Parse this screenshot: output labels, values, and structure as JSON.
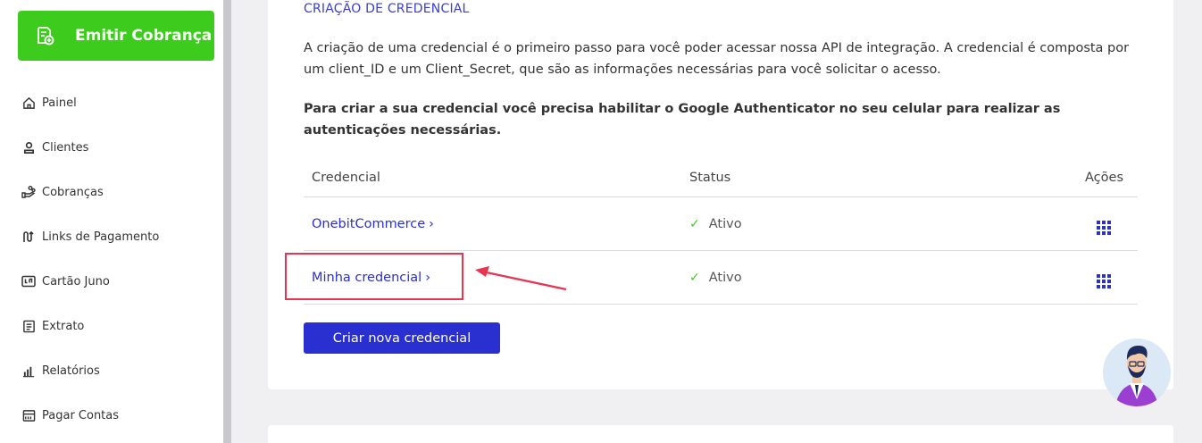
{
  "sidebar": {
    "emit_button": "Emitir Cobrança",
    "items": [
      {
        "label": "Painel",
        "icon": "home-icon"
      },
      {
        "label": "Clientes",
        "icon": "user-icon"
      },
      {
        "label": "Cobranças",
        "icon": "hand-coins-icon"
      },
      {
        "label": "Links de Pagamento",
        "icon": "link-icon"
      },
      {
        "label": "Cartão Juno",
        "icon": "card-icon"
      },
      {
        "label": "Extrato",
        "icon": "receipt-icon"
      },
      {
        "label": "Relatórios",
        "icon": "bar-chart-icon"
      },
      {
        "label": "Pagar Contas",
        "icon": "barcode-icon"
      }
    ]
  },
  "main": {
    "section_title": "CRIAÇÃO DE CREDENCIAL",
    "description": "A criação de uma credencial é o primeiro passo para você poder acessar nossa API de integração. A credencial é composta por um client_ID e um Client_Secret, que são as informações necessárias para você solicitar o acesso.",
    "notice": "Para criar a sua credencial você precisa habilitar o Google Authenticator no seu celular para realizar as autenticações necessárias.",
    "table": {
      "headers": {
        "credential": "Credencial",
        "status": "Status",
        "actions": "Ações"
      },
      "rows": [
        {
          "credential": "OnebitCommerce",
          "status": "Ativo"
        },
        {
          "credential": "Minha credencial",
          "status": "Ativo"
        }
      ]
    },
    "create_button": "Criar nova credencial"
  },
  "colors": {
    "primary": "#2a2fcf",
    "emit_green": "#3dcb1e",
    "highlight_red": "#e8344e"
  }
}
